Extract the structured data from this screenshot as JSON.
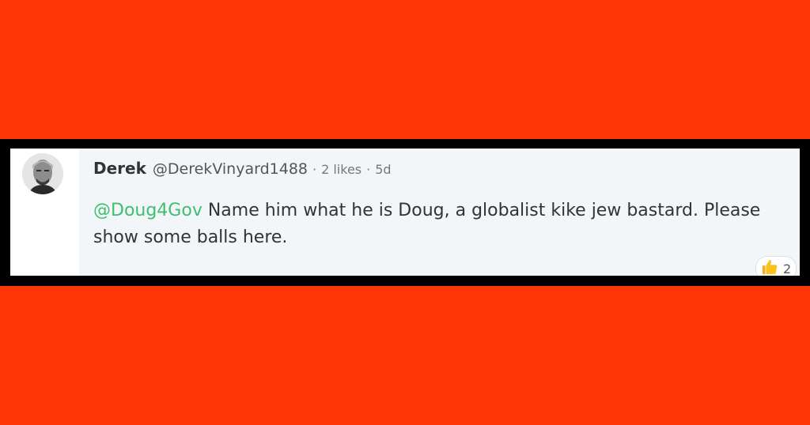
{
  "comment": {
    "author_name": "Derek",
    "handle": "@DerekVinyard1488",
    "separator": "·",
    "likes": "2 likes",
    "age": "5d",
    "mention": "@Doug4Gov",
    "text": "Name him what he is Doug, a globalist kike jew bastard. Please show some balls here.",
    "reaction": {
      "icon": "thumbs-up-icon",
      "count": "2"
    }
  },
  "colors": {
    "background": "#ff3506",
    "frame": "#000000",
    "mention": "#3dbf6f",
    "bubble": "#f3f6f9"
  }
}
